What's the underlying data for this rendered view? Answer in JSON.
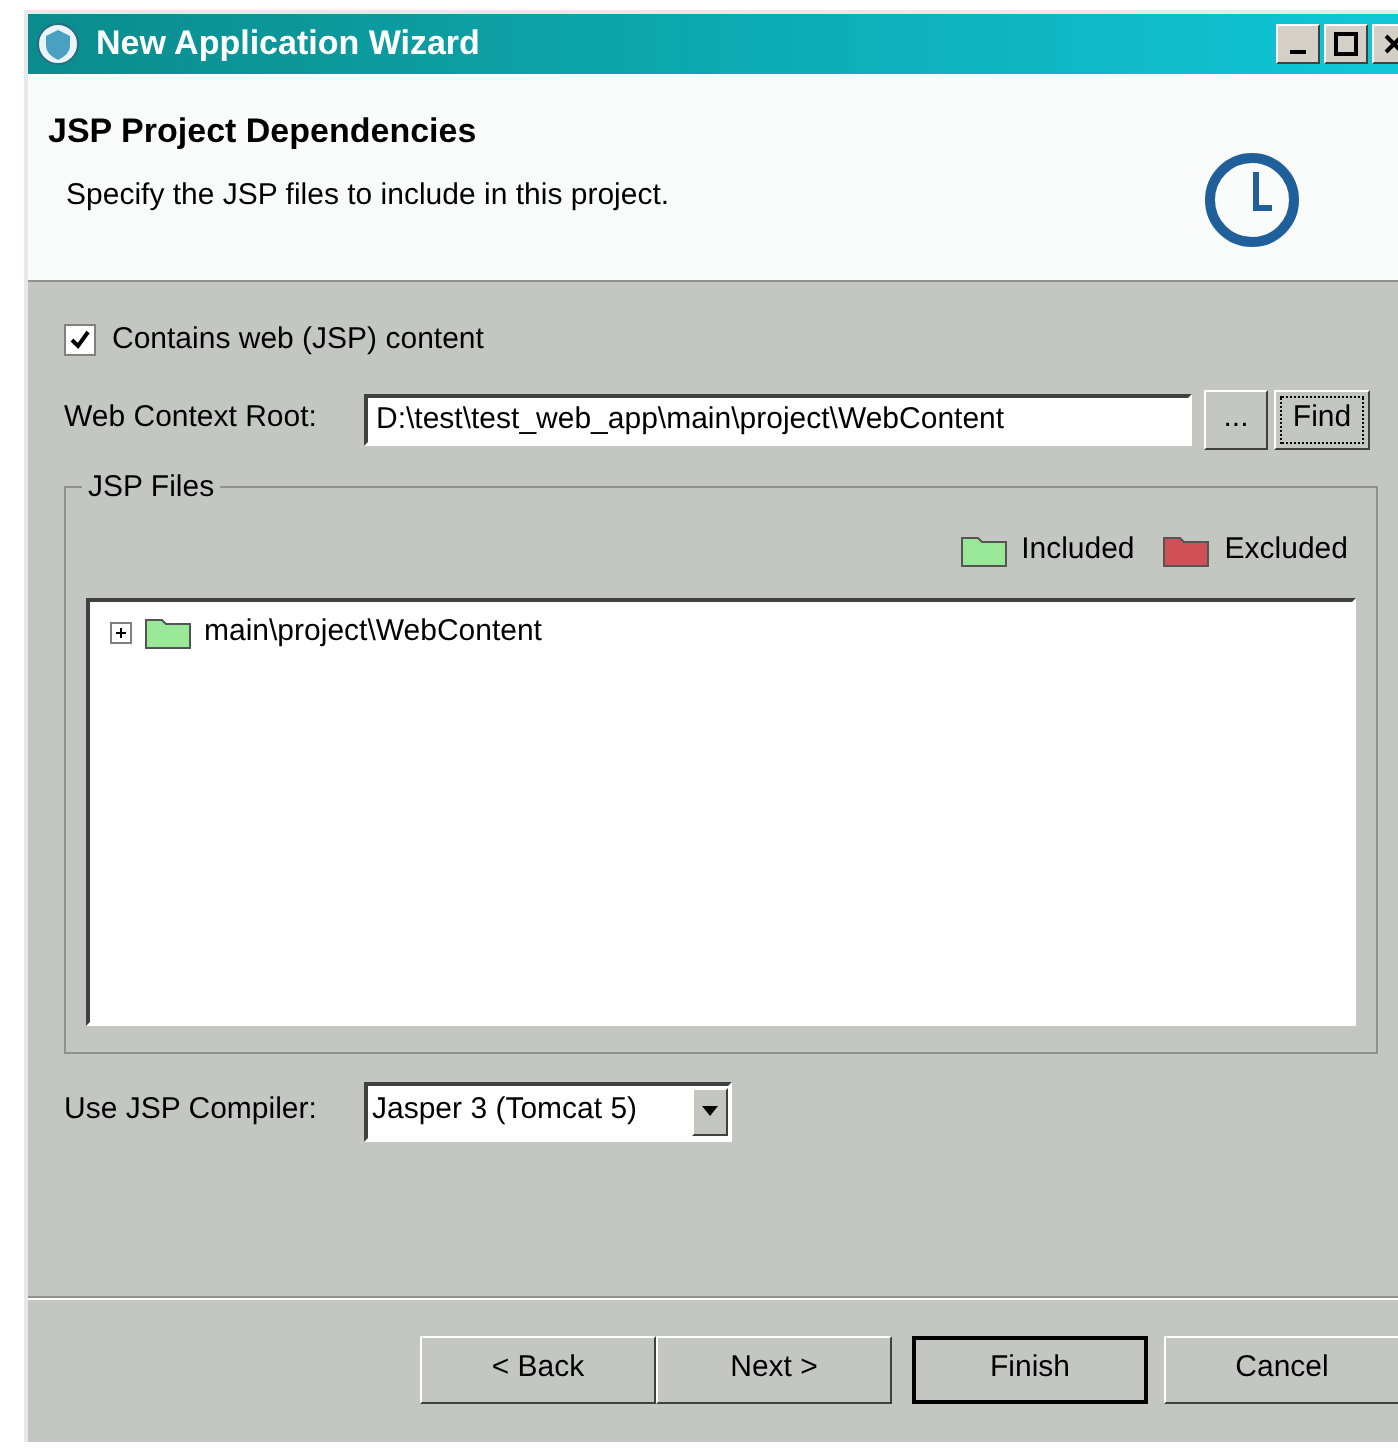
{
  "window": {
    "title": "New Application Wizard"
  },
  "header": {
    "title": "JSP Project Dependencies",
    "description": "Specify the JSP files to include in this project."
  },
  "web_content": {
    "label": "Contains web (JSP) content",
    "checked": true
  },
  "context_root": {
    "label": "Web Context Root:",
    "value": "D:\\test\\test_web_app\\main\\project\\WebContent",
    "browse": "...",
    "find": "Find"
  },
  "jsp_files": {
    "title": "JSP Files",
    "legend": [
      {
        "label": "Included",
        "color": "#98e898"
      },
      {
        "label": "Excluded",
        "color": "#d05058"
      }
    ],
    "tree": [
      {
        "label": "main\\project\\WebContent",
        "expanded": false,
        "color": "#98e898"
      }
    ]
  },
  "compiler": {
    "label": "Use JSP Compiler:",
    "value": "Jasper 3 (Tomcat 5)"
  },
  "buttons": [
    {
      "label": "< Back",
      "default": false
    },
    {
      "label": "Next >",
      "default": false
    },
    {
      "label": "Finish",
      "default": true
    },
    {
      "label": "Cancel",
      "default": false
    }
  ]
}
